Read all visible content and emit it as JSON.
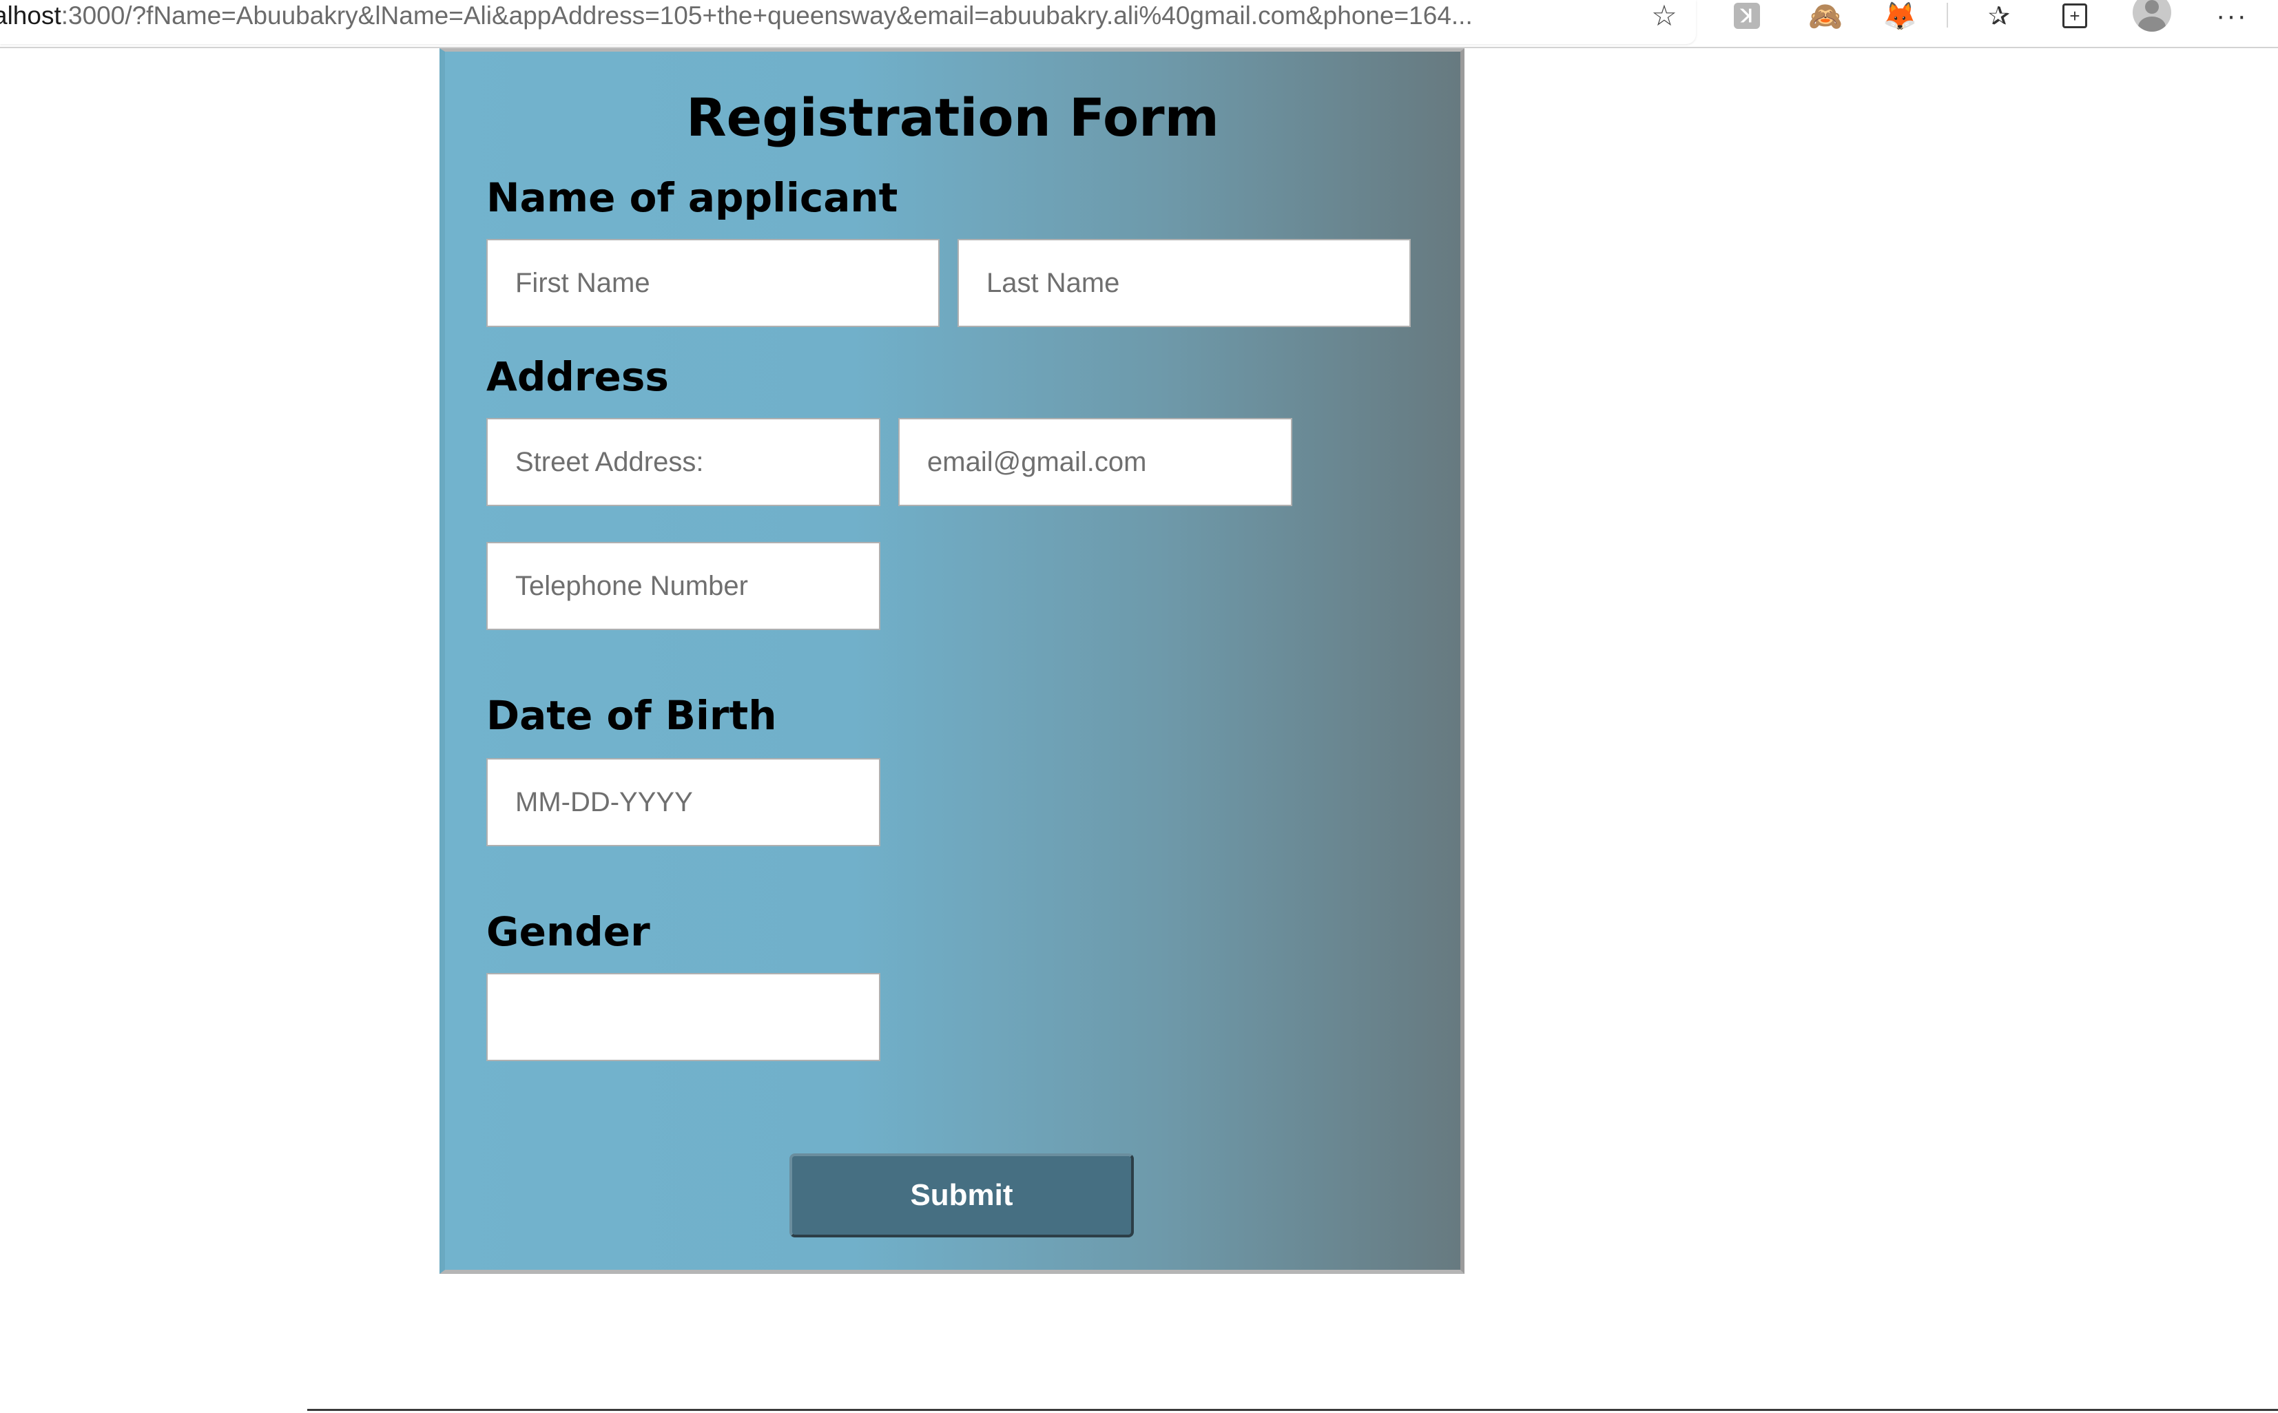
{
  "browser": {
    "url_prefix": "alhost",
    "url_rest": ":3000/?fName=Abuubakry&lName=Ali&appAddress=105+the+queensway&email=abuubakry.ali%40gmail.com&phone=164...",
    "icons": [
      "star-icon",
      "extension-k-icon",
      "extension-monkey-icon",
      "metamask-fox-icon",
      "favorites-icon",
      "collections-icon",
      "profile-icon",
      "more-icon"
    ]
  },
  "form": {
    "title": "Registration Form",
    "sections": {
      "name": "Name of applicant",
      "address": "Address",
      "dob": "Date of Birth",
      "gender": "Gender"
    },
    "fields": {
      "first_name": {
        "placeholder": "First Name",
        "value": ""
      },
      "last_name": {
        "placeholder": "Last Name",
        "value": ""
      },
      "street_address": {
        "placeholder": "Street Address:",
        "value": ""
      },
      "email": {
        "placeholder": "email@gmail.com",
        "value": ""
      },
      "telephone": {
        "placeholder": "Telephone Number",
        "value": ""
      },
      "dob": {
        "placeholder": "MM-DD-YYYY",
        "value": ""
      },
      "gender": {
        "placeholder": "",
        "value": ""
      }
    },
    "submit_label": "Submit"
  },
  "colors": {
    "panel_gradient_start": "#72b3cd",
    "panel_gradient_end": "#677a80",
    "submit_bg": "#466f82"
  }
}
